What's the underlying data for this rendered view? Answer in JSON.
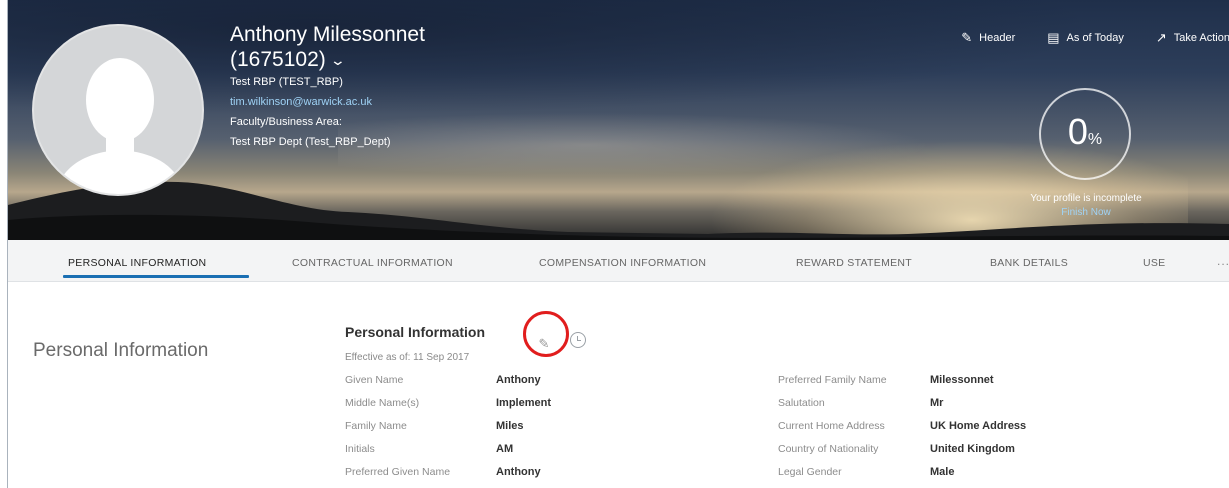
{
  "profile": {
    "name": "Anthony Milessonnet",
    "employee_id": "(1675102)",
    "role": "Test RBP (TEST_RBP)",
    "email": "tim.wilkinson@warwick.ac.uk",
    "area_label": "Faculty/Business Area:",
    "dept": "Test RBP Dept (Test_RBP_Dept)"
  },
  "header_actions": [
    {
      "label": "Header",
      "icon": "pencil-icon"
    },
    {
      "label": "As of Today",
      "icon": "calendar-icon"
    },
    {
      "label": "Take Action",
      "icon": "external-link-icon"
    }
  ],
  "profile_completion": {
    "value": "0",
    "unit": "%",
    "percent": 0,
    "message": "Your profile is incomplete",
    "link": "Finish Now"
  },
  "tabs": [
    {
      "label": "PERSONAL INFORMATION",
      "active": true
    },
    {
      "label": "CONTRACTUAL INFORMATION",
      "active": false
    },
    {
      "label": "COMPENSATION INFORMATION",
      "active": false
    },
    {
      "label": "REWARD STATEMENT",
      "active": false
    },
    {
      "label": "BANK DETAILS",
      "active": false
    },
    {
      "label": "USE",
      "active": false
    }
  ],
  "tabs_more": "...",
  "section": {
    "label": "Personal Information",
    "card_title": "Personal Information",
    "effective": "Effective as of: 11 Sep 2017",
    "left_fields": [
      {
        "label": "Given Name",
        "value": "Anthony"
      },
      {
        "label": "Middle Name(s)",
        "value": "Implement"
      },
      {
        "label": "Family Name",
        "value": "Miles"
      },
      {
        "label": "Initials",
        "value": "AM"
      },
      {
        "label": "Preferred Given Name",
        "value": "Anthony"
      }
    ],
    "right_fields": [
      {
        "label": "Preferred Family Name",
        "value": "Milessonnet"
      },
      {
        "label": "Salutation",
        "value": "Mr"
      },
      {
        "label": "Current Home Address",
        "value": "UK Home Address"
      },
      {
        "label": "Country of Nationality",
        "value": "United Kingdom"
      },
      {
        "label": "Legal Gender",
        "value": "Male"
      }
    ]
  },
  "colors": {
    "accent": "#1a6fb3",
    "highlight": "#e11d1d",
    "link": "#9fd2f5"
  }
}
